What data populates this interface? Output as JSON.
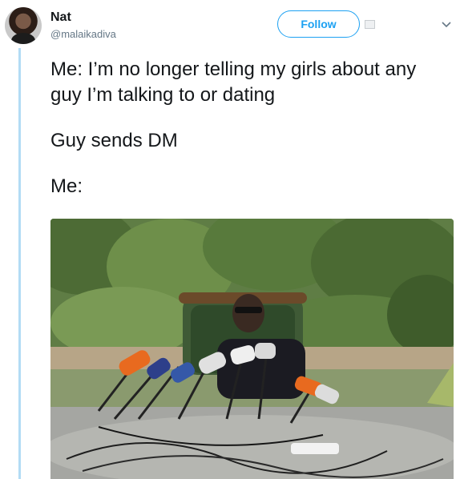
{
  "user": {
    "name": "Nat",
    "handle": "@malaikadiva"
  },
  "follow_label": "Follow",
  "tweet": {
    "lines": [
      "Me: I’m no longer telling my girls about any guy I’m talking to or dating",
      "Guy sends DM",
      "Me:"
    ]
  },
  "icons": {
    "avatar": "profile-photo",
    "caret": "chevron-down-icon",
    "badge": "card-icon"
  },
  "colors": {
    "accent": "#1da1f2",
    "thread_line": "#b3dcf5",
    "handle": "#657786",
    "text": "#14171a"
  }
}
